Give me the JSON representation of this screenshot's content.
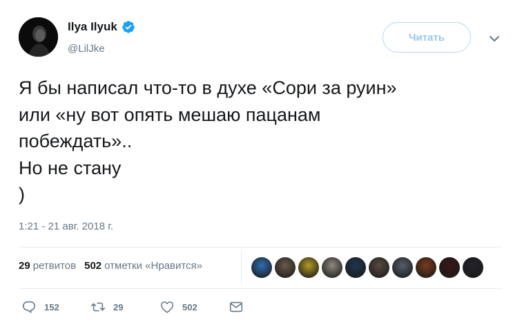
{
  "author": {
    "name": "Ilya Ilyuk",
    "handle": "@LilJke",
    "avatar_icon": "avatar-dark-portrait",
    "verified_icon": "verified-badge-icon",
    "verified_color": "#1da1f2"
  },
  "header": {
    "follow_label": "Читать",
    "more_icon": "chevron-down-icon"
  },
  "tweet": {
    "lines": [
      "Я бы написал что-то в духе «Сори за руин»",
      "или «ну вот опять мешаю пацанам",
      "побеждать»..",
      "Но не стану",
      ")"
    ],
    "timestamp": "1:21 - 21 авг. 2018 г."
  },
  "stats": {
    "retweets_count": "29",
    "retweets_label": "ретвитов",
    "likes_count": "502",
    "likes_label": "отметки «Нравится»"
  },
  "likers": [
    {
      "icon": "liker-avatar-blue-creature",
      "color": "#2f6fb3"
    },
    {
      "icon": "liker-avatar-portrait",
      "color": "#6b5a4a"
    },
    {
      "icon": "liker-avatar-yellow",
      "color": "#b49a24"
    },
    {
      "icon": "liker-avatar-grey-animal",
      "color": "#8f8a80"
    },
    {
      "icon": "liker-avatar-dark-blue",
      "color": "#1e3550"
    },
    {
      "icon": "liker-avatar-face",
      "color": "#5a4a44"
    },
    {
      "icon": "liker-avatar-multicolor",
      "color": "#55606a"
    },
    {
      "icon": "liker-avatar-sunset",
      "color": "#7a3a1a"
    },
    {
      "icon": "liker-avatar-dark-red",
      "color": "#3a1616"
    },
    {
      "icon": "liker-avatar-night",
      "color": "#23222a"
    }
  ],
  "actions": {
    "reply_count": "152",
    "retweet_count": "29",
    "like_count": "502",
    "icons": [
      "reply-icon",
      "retweet-icon",
      "like-icon",
      "message-icon"
    ]
  },
  "colors": {
    "text": "#14171a",
    "secondary": "#657786",
    "accent": "#1da1f2",
    "divider": "#e6ecf0"
  }
}
